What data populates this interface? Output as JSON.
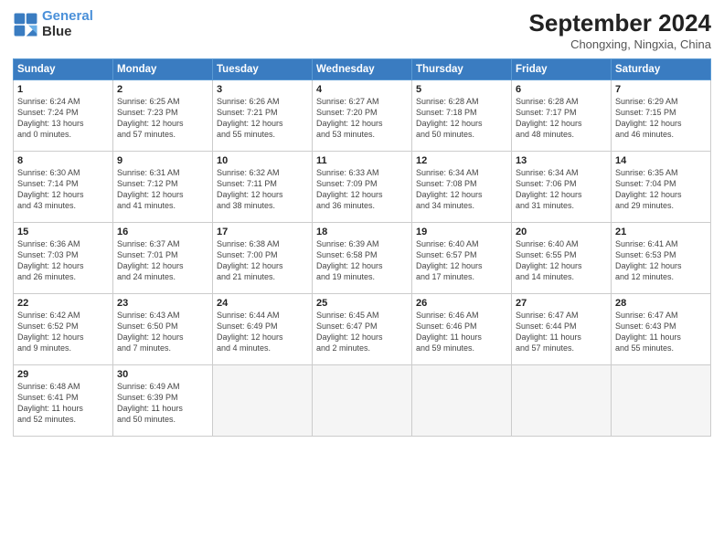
{
  "header": {
    "logo_line1": "General",
    "logo_line2": "Blue",
    "month_year": "September 2024",
    "location": "Chongxing, Ningxia, China"
  },
  "weekdays": [
    "Sunday",
    "Monday",
    "Tuesday",
    "Wednesday",
    "Thursday",
    "Friday",
    "Saturday"
  ],
  "weeks": [
    [
      {
        "day": "1",
        "lines": [
          "Sunrise: 6:24 AM",
          "Sunset: 7:24 PM",
          "Daylight: 13 hours",
          "and 0 minutes."
        ]
      },
      {
        "day": "2",
        "lines": [
          "Sunrise: 6:25 AM",
          "Sunset: 7:23 PM",
          "Daylight: 12 hours",
          "and 57 minutes."
        ]
      },
      {
        "day": "3",
        "lines": [
          "Sunrise: 6:26 AM",
          "Sunset: 7:21 PM",
          "Daylight: 12 hours",
          "and 55 minutes."
        ]
      },
      {
        "day": "4",
        "lines": [
          "Sunrise: 6:27 AM",
          "Sunset: 7:20 PM",
          "Daylight: 12 hours",
          "and 53 minutes."
        ]
      },
      {
        "day": "5",
        "lines": [
          "Sunrise: 6:28 AM",
          "Sunset: 7:18 PM",
          "Daylight: 12 hours",
          "and 50 minutes."
        ]
      },
      {
        "day": "6",
        "lines": [
          "Sunrise: 6:28 AM",
          "Sunset: 7:17 PM",
          "Daylight: 12 hours",
          "and 48 minutes."
        ]
      },
      {
        "day": "7",
        "lines": [
          "Sunrise: 6:29 AM",
          "Sunset: 7:15 PM",
          "Daylight: 12 hours",
          "and 46 minutes."
        ]
      }
    ],
    [
      {
        "day": "8",
        "lines": [
          "Sunrise: 6:30 AM",
          "Sunset: 7:14 PM",
          "Daylight: 12 hours",
          "and 43 minutes."
        ]
      },
      {
        "day": "9",
        "lines": [
          "Sunrise: 6:31 AM",
          "Sunset: 7:12 PM",
          "Daylight: 12 hours",
          "and 41 minutes."
        ]
      },
      {
        "day": "10",
        "lines": [
          "Sunrise: 6:32 AM",
          "Sunset: 7:11 PM",
          "Daylight: 12 hours",
          "and 38 minutes."
        ]
      },
      {
        "day": "11",
        "lines": [
          "Sunrise: 6:33 AM",
          "Sunset: 7:09 PM",
          "Daylight: 12 hours",
          "and 36 minutes."
        ]
      },
      {
        "day": "12",
        "lines": [
          "Sunrise: 6:34 AM",
          "Sunset: 7:08 PM",
          "Daylight: 12 hours",
          "and 34 minutes."
        ]
      },
      {
        "day": "13",
        "lines": [
          "Sunrise: 6:34 AM",
          "Sunset: 7:06 PM",
          "Daylight: 12 hours",
          "and 31 minutes."
        ]
      },
      {
        "day": "14",
        "lines": [
          "Sunrise: 6:35 AM",
          "Sunset: 7:04 PM",
          "Daylight: 12 hours",
          "and 29 minutes."
        ]
      }
    ],
    [
      {
        "day": "15",
        "lines": [
          "Sunrise: 6:36 AM",
          "Sunset: 7:03 PM",
          "Daylight: 12 hours",
          "and 26 minutes."
        ]
      },
      {
        "day": "16",
        "lines": [
          "Sunrise: 6:37 AM",
          "Sunset: 7:01 PM",
          "Daylight: 12 hours",
          "and 24 minutes."
        ]
      },
      {
        "day": "17",
        "lines": [
          "Sunrise: 6:38 AM",
          "Sunset: 7:00 PM",
          "Daylight: 12 hours",
          "and 21 minutes."
        ]
      },
      {
        "day": "18",
        "lines": [
          "Sunrise: 6:39 AM",
          "Sunset: 6:58 PM",
          "Daylight: 12 hours",
          "and 19 minutes."
        ]
      },
      {
        "day": "19",
        "lines": [
          "Sunrise: 6:40 AM",
          "Sunset: 6:57 PM",
          "Daylight: 12 hours",
          "and 17 minutes."
        ]
      },
      {
        "day": "20",
        "lines": [
          "Sunrise: 6:40 AM",
          "Sunset: 6:55 PM",
          "Daylight: 12 hours",
          "and 14 minutes."
        ]
      },
      {
        "day": "21",
        "lines": [
          "Sunrise: 6:41 AM",
          "Sunset: 6:53 PM",
          "Daylight: 12 hours",
          "and 12 minutes."
        ]
      }
    ],
    [
      {
        "day": "22",
        "lines": [
          "Sunrise: 6:42 AM",
          "Sunset: 6:52 PM",
          "Daylight: 12 hours",
          "and 9 minutes."
        ]
      },
      {
        "day": "23",
        "lines": [
          "Sunrise: 6:43 AM",
          "Sunset: 6:50 PM",
          "Daylight: 12 hours",
          "and 7 minutes."
        ]
      },
      {
        "day": "24",
        "lines": [
          "Sunrise: 6:44 AM",
          "Sunset: 6:49 PM",
          "Daylight: 12 hours",
          "and 4 minutes."
        ]
      },
      {
        "day": "25",
        "lines": [
          "Sunrise: 6:45 AM",
          "Sunset: 6:47 PM",
          "Daylight: 12 hours",
          "and 2 minutes."
        ]
      },
      {
        "day": "26",
        "lines": [
          "Sunrise: 6:46 AM",
          "Sunset: 6:46 PM",
          "Daylight: 11 hours",
          "and 59 minutes."
        ]
      },
      {
        "day": "27",
        "lines": [
          "Sunrise: 6:47 AM",
          "Sunset: 6:44 PM",
          "Daylight: 11 hours",
          "and 57 minutes."
        ]
      },
      {
        "day": "28",
        "lines": [
          "Sunrise: 6:47 AM",
          "Sunset: 6:43 PM",
          "Daylight: 11 hours",
          "and 55 minutes."
        ]
      }
    ],
    [
      {
        "day": "29",
        "lines": [
          "Sunrise: 6:48 AM",
          "Sunset: 6:41 PM",
          "Daylight: 11 hours",
          "and 52 minutes."
        ]
      },
      {
        "day": "30",
        "lines": [
          "Sunrise: 6:49 AM",
          "Sunset: 6:39 PM",
          "Daylight: 11 hours",
          "and 50 minutes."
        ]
      },
      {
        "day": "",
        "lines": []
      },
      {
        "day": "",
        "lines": []
      },
      {
        "day": "",
        "lines": []
      },
      {
        "day": "",
        "lines": []
      },
      {
        "day": "",
        "lines": []
      }
    ]
  ]
}
